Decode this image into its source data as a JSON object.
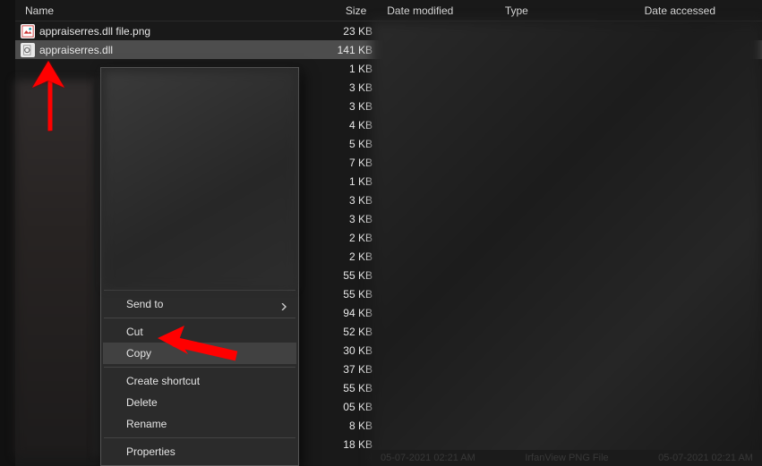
{
  "columns": {
    "name": "Name",
    "size": "Size",
    "date": "Date modified",
    "type": "Type",
    "accessed": "Date accessed"
  },
  "files": [
    {
      "name": "appraiserres.dll file.png",
      "size": "23 KB",
      "icon": "png"
    },
    {
      "name": "appraiserres.dll",
      "size": "141 KB",
      "icon": "dll",
      "selected": true
    }
  ],
  "obscured_sizes": [
    "1 KB",
    "3 KB",
    "3 KB",
    "4 KB",
    "5 KB",
    "7 KB",
    "1 KB",
    "3 KB",
    "3 KB",
    "2 KB",
    "2 KB",
    "55 KB",
    "55 KB",
    "94 KB",
    "52 KB",
    "30 KB",
    "37 KB",
    "55 KB",
    "05 KB",
    "8 KB",
    "18 KB"
  ],
  "context_menu": {
    "send_to": "Send to",
    "cut": "Cut",
    "copy": "Copy",
    "create_shortcut": "Create shortcut",
    "delete": "Delete",
    "rename": "Rename",
    "properties": "Properties"
  },
  "status": {
    "left": "05-07-2021 02:21 AM",
    "mid": "IrfanView PNG File",
    "right": "05-07-2021 02:21 AM"
  },
  "colors": {
    "arrow": "#ff0000"
  }
}
